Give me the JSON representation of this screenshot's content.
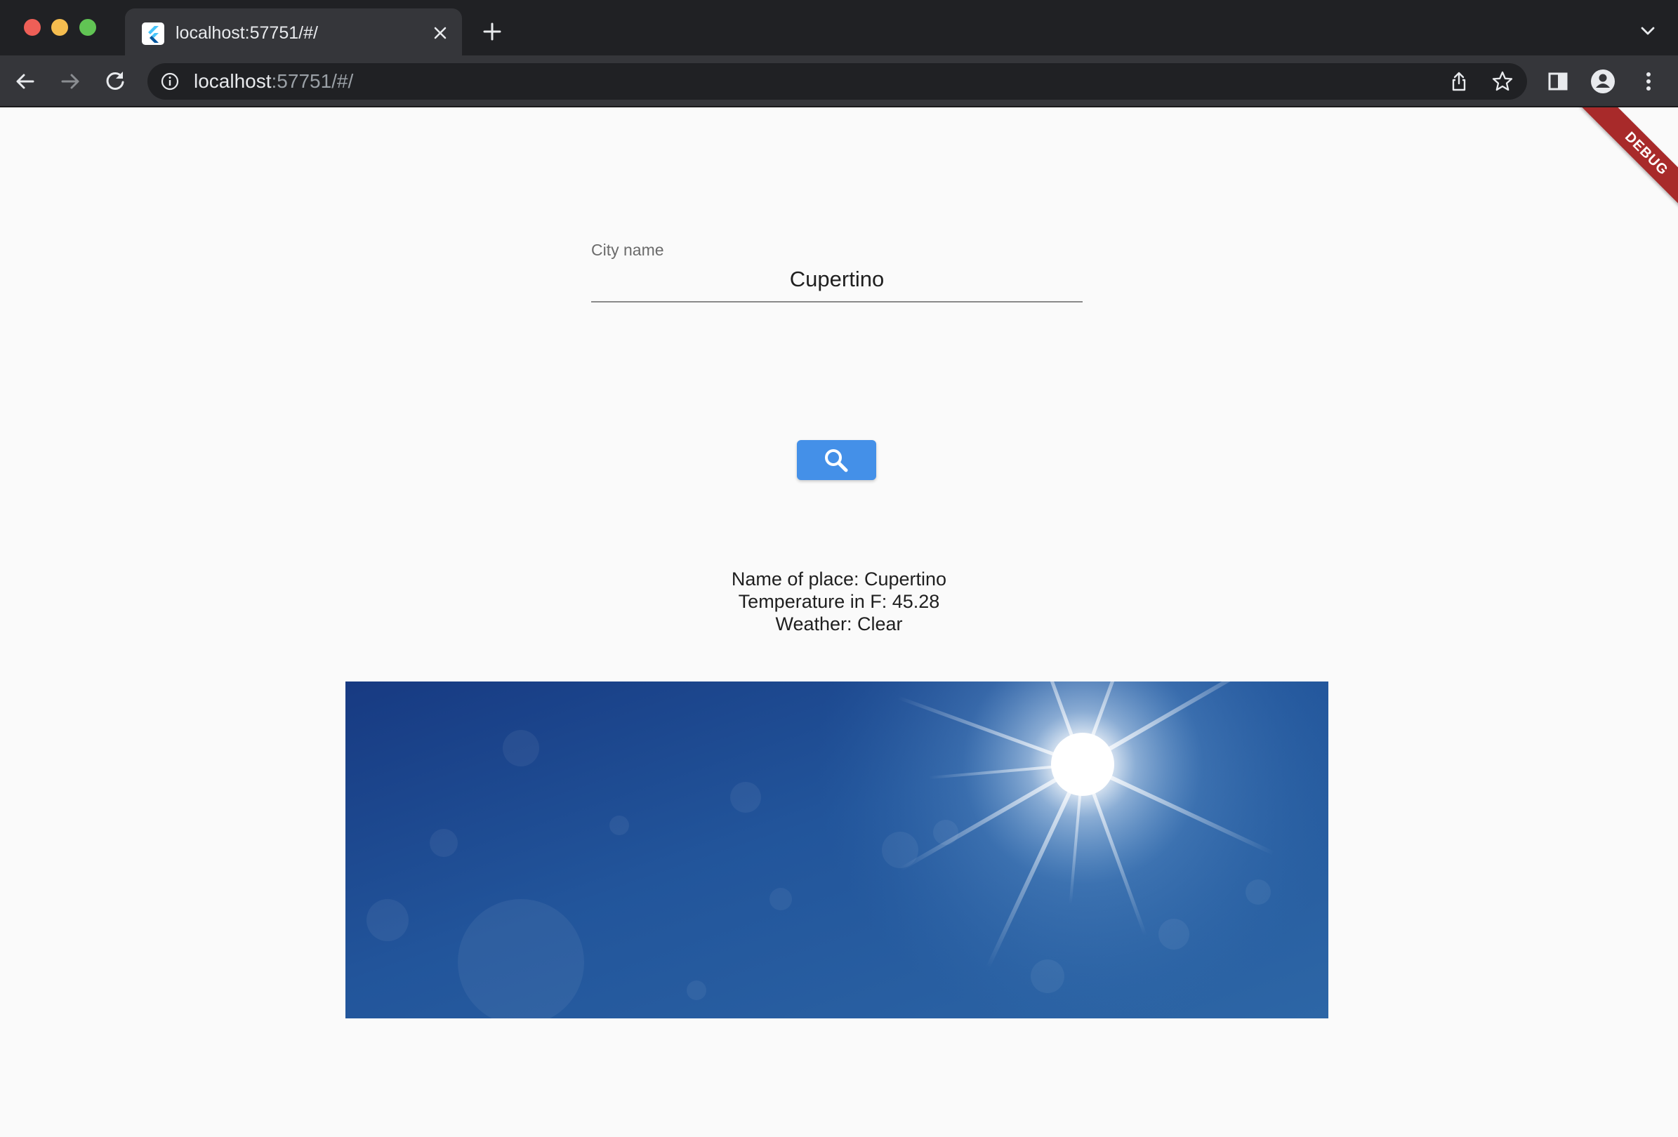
{
  "browser": {
    "tab_title": "localhost:57751/#/",
    "url_host": "localhost",
    "url_rest": ":57751/#/",
    "icons": [
      "flutter-favicon",
      "close-icon",
      "plus-icon",
      "chevron-down-icon",
      "back-arrow-icon",
      "forward-arrow-icon",
      "reload-icon",
      "info-icon",
      "share-icon",
      "star-icon",
      "side-panel-icon",
      "profile-icon",
      "more-vert-icon"
    ]
  },
  "app": {
    "debug_banner": "DEBUG",
    "city_field": {
      "label": "City name",
      "value": "Cupertino"
    },
    "search_button": {
      "icon": "search-icon"
    },
    "result": {
      "place": "Name of place: Cupertino",
      "temperature": "Temperature in F: 45.28",
      "weather": "Weather: Clear"
    },
    "image": "clear-sky-sun-image"
  },
  "colors": {
    "accent": "#4490e8",
    "debug_banner": "#a82a2a",
    "chrome_dark": "#202124",
    "chrome_toolbar": "#35363a"
  }
}
